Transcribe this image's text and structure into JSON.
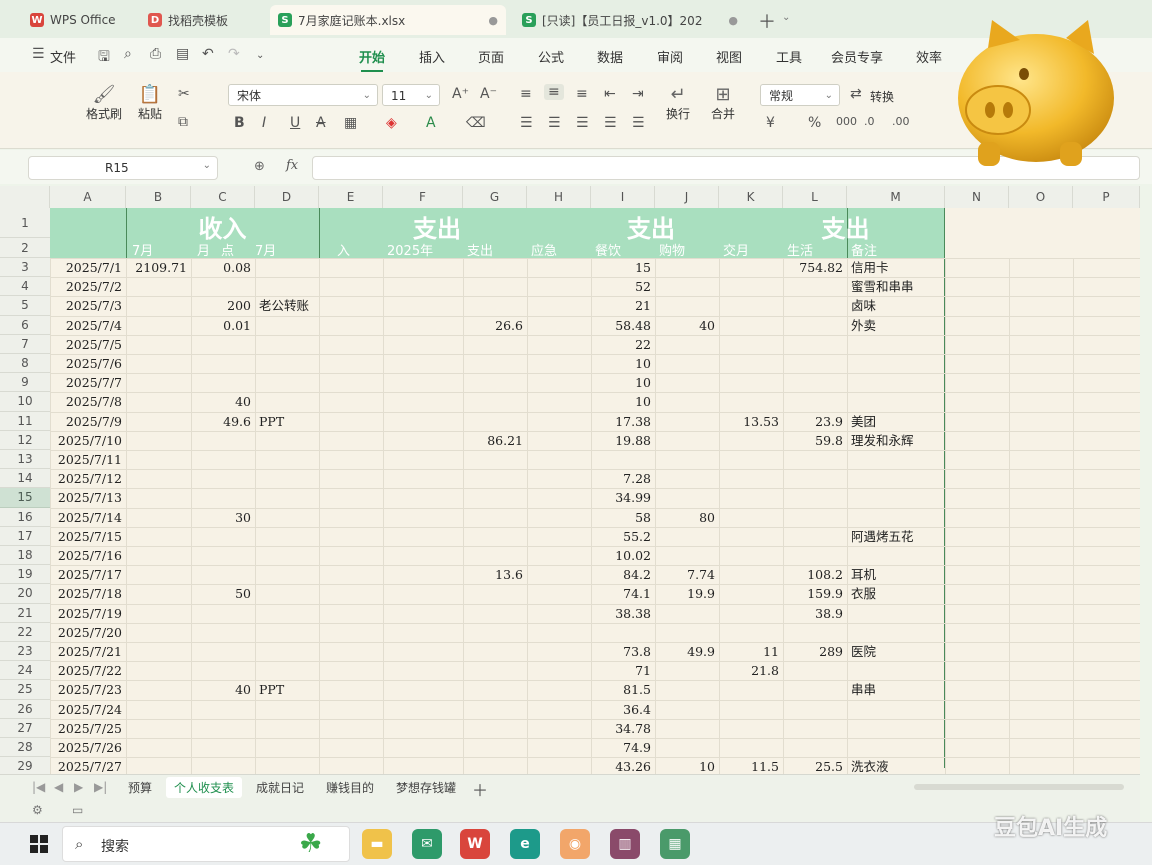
{
  "tabs": [
    {
      "label": "WPS Office",
      "icon": "wps-logo-icon"
    },
    {
      "label": "找稻壳模板",
      "icon": "docer-icon"
    },
    {
      "label": "7月家庭记账本.xlsx",
      "icon": "spreadsheet-icon"
    },
    {
      "label": "[只读]【员工日报_v1.0】202",
      "icon": "spreadsheet-icon"
    }
  ],
  "menu": {
    "file": "文件",
    "items": [
      "开始",
      "插入",
      "页面",
      "公式",
      "数据",
      "审阅",
      "视图",
      "工具",
      "会员专享",
      "效率"
    ]
  },
  "ribbon": {
    "format_painter": "格式刷",
    "paste": "粘贴",
    "font_name": "宋体",
    "font_size": "11",
    "wrap": "换行",
    "merge": "合并",
    "number_format": "常规",
    "convert": "转换"
  },
  "formula_bar": {
    "cell_ref": "R15",
    "fx": "fx"
  },
  "columns": [
    "A",
    "B",
    "C",
    "D",
    "E",
    "F",
    "G",
    "H",
    "I",
    "J",
    "K",
    "L",
    "M",
    "N",
    "O",
    "P"
  ],
  "headers": {
    "income": "收入",
    "expense1": "支出",
    "expense2": "支出",
    "expense3": "支出",
    "row2": [
      "7月",
      "月",
      "点",
      "7月",
      "入",
      "2025年",
      "支出",
      "应急",
      "餐饮",
      "购物",
      "交月",
      "生活",
      "备注"
    ]
  },
  "rows": [
    {
      "n": "3",
      "date": "2025/7/1",
      "B": "2109.71",
      "C": "0.08",
      "D": "",
      "G": "",
      "I": "15",
      "J": "",
      "K": "",
      "L": "754.82",
      "M": "信用卡"
    },
    {
      "n": "4",
      "date": "2025/7/2",
      "B": "",
      "C": "",
      "D": "",
      "G": "",
      "I": "52",
      "J": "",
      "K": "",
      "L": "",
      "M": "蜜雪和串串"
    },
    {
      "n": "5",
      "date": "2025/7/3",
      "B": "",
      "C": "200",
      "D": "老公转账",
      "G": "",
      "I": "21",
      "J": "",
      "K": "",
      "L": "",
      "M": "卤味"
    },
    {
      "n": "6",
      "date": "2025/7/4",
      "B": "",
      "C": "0.01",
      "D": "",
      "G": "26.6",
      "I": "58.48",
      "J": "40",
      "K": "",
      "L": "",
      "M": "外卖"
    },
    {
      "n": "7",
      "date": "2025/7/5",
      "B": "",
      "C": "",
      "D": "",
      "G": "",
      "I": "22",
      "J": "",
      "K": "",
      "L": "",
      "M": ""
    },
    {
      "n": "8",
      "date": "2025/7/6",
      "B": "",
      "C": "",
      "D": "",
      "G": "",
      "I": "10",
      "J": "",
      "K": "",
      "L": "",
      "M": ""
    },
    {
      "n": "9",
      "date": "2025/7/7",
      "B": "",
      "C": "",
      "D": "",
      "G": "",
      "I": "10",
      "J": "",
      "K": "",
      "L": "",
      "M": ""
    },
    {
      "n": "10",
      "date": "2025/7/8",
      "B": "",
      "C": "40",
      "D": "",
      "G": "",
      "I": "10",
      "J": "",
      "K": "",
      "L": "",
      "M": ""
    },
    {
      "n": "11",
      "date": "2025/7/9",
      "B": "",
      "C": "49.6",
      "D": "PPT",
      "G": "",
      "I": "17.38",
      "J": "",
      "K": "13.53",
      "L": "23.9",
      "M": "美团"
    },
    {
      "n": "12",
      "date": "2025/7/10",
      "B": "",
      "C": "",
      "D": "",
      "G": "86.21",
      "I": "19.88",
      "J": "",
      "K": "",
      "L": "59.8",
      "M": "理发和永辉"
    },
    {
      "n": "13",
      "date": "2025/7/11",
      "B": "",
      "C": "",
      "D": "",
      "G": "",
      "I": "",
      "J": "",
      "K": "",
      "L": "",
      "M": ""
    },
    {
      "n": "14",
      "date": "2025/7/12",
      "B": "",
      "C": "",
      "D": "",
      "G": "",
      "I": "7.28",
      "J": "",
      "K": "",
      "L": "",
      "M": ""
    },
    {
      "n": "15",
      "date": "2025/7/13",
      "B": "",
      "C": "",
      "D": "",
      "G": "",
      "I": "34.99",
      "J": "",
      "K": "",
      "L": "",
      "M": ""
    },
    {
      "n": "16",
      "date": "2025/7/14",
      "B": "",
      "C": "30",
      "D": "",
      "G": "",
      "I": "58",
      "J": "80",
      "K": "",
      "L": "",
      "M": ""
    },
    {
      "n": "17",
      "date": "2025/7/15",
      "B": "",
      "C": "",
      "D": "",
      "G": "",
      "I": "55.2",
      "J": "",
      "K": "",
      "L": "",
      "M": "阿遇烤五花"
    },
    {
      "n": "18",
      "date": "2025/7/16",
      "B": "",
      "C": "",
      "D": "",
      "G": "",
      "I": "10.02",
      "J": "",
      "K": "",
      "L": "",
      "M": ""
    },
    {
      "n": "19",
      "date": "2025/7/17",
      "B": "",
      "C": "",
      "D": "",
      "G": "13.6",
      "I": "84.2",
      "J": "7.74",
      "K": "",
      "L": "108.2",
      "M": "耳机"
    },
    {
      "n": "20",
      "date": "2025/7/18",
      "B": "",
      "C": "50",
      "D": "",
      "G": "",
      "I": "74.1",
      "J": "19.9",
      "K": "",
      "L": "159.9",
      "M": "衣服"
    },
    {
      "n": "21",
      "date": "2025/7/19",
      "B": "",
      "C": "",
      "D": "",
      "G": "",
      "I": "38.38",
      "J": "",
      "K": "",
      "L": "38.9",
      "M": ""
    },
    {
      "n": "22",
      "date": "2025/7/20",
      "B": "",
      "C": "",
      "D": "",
      "G": "",
      "I": "",
      "J": "",
      "K": "",
      "L": "",
      "M": ""
    },
    {
      "n": "23",
      "date": "2025/7/21",
      "B": "",
      "C": "",
      "D": "",
      "G": "",
      "I": "73.8",
      "J": "49.9",
      "K": "11",
      "L": "289",
      "M": "医院"
    },
    {
      "n": "24",
      "date": "2025/7/22",
      "B": "",
      "C": "",
      "D": "",
      "G": "",
      "I": "71",
      "J": "",
      "K": "21.8",
      "L": "",
      "M": ""
    },
    {
      "n": "25",
      "date": "2025/7/23",
      "B": "",
      "C": "40",
      "D": "PPT",
      "G": "",
      "I": "81.5",
      "J": "",
      "K": "",
      "L": "",
      "M": "串串"
    },
    {
      "n": "26",
      "date": "2025/7/24",
      "B": "",
      "C": "",
      "D": "",
      "G": "",
      "I": "36.4",
      "J": "",
      "K": "",
      "L": "",
      "M": ""
    },
    {
      "n": "27",
      "date": "2025/7/25",
      "B": "",
      "C": "",
      "D": "",
      "G": "",
      "I": "34.78",
      "J": "",
      "K": "",
      "L": "",
      "M": ""
    },
    {
      "n": "28",
      "date": "2025/7/26",
      "B": "",
      "C": "",
      "D": "",
      "G": "",
      "I": "74.9",
      "J": "",
      "K": "",
      "L": "",
      "M": ""
    },
    {
      "n": "29",
      "date": "2025/7/27",
      "B": "",
      "C": "",
      "D": "",
      "G": "",
      "I": "43.26",
      "J": "10",
      "K": "11.5",
      "L": "25.5",
      "M": "洗衣液"
    }
  ],
  "sheets": [
    "预算",
    "个人收支表",
    "成就日记",
    "赚钱目的",
    "梦想存钱罐"
  ],
  "active_sheet": "个人收支表",
  "taskbar": {
    "search_label": "搜索"
  },
  "watermark": "豆包AI生成",
  "colors": {
    "accent": "#1f8f4e",
    "header_band": "#a9dfbf",
    "sheet_bg": "#f7f2e6"
  }
}
